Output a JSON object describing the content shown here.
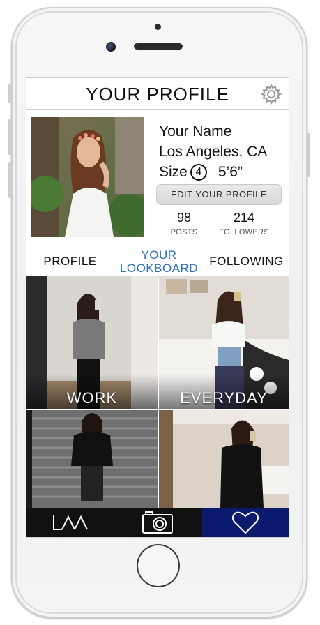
{
  "header": {
    "title": "YOUR PROFILE",
    "settings_icon": "gear-icon"
  },
  "profile": {
    "name": "Your Name",
    "location": "Los Angeles, CA",
    "size_label": "Size",
    "size_value": "4",
    "height": "5’6”",
    "edit_label": "EDIT YOUR PROFILE"
  },
  "stats": {
    "posts": {
      "value": "98",
      "label": "POSTS"
    },
    "followers": {
      "value": "214",
      "label": "FOLLOWERS"
    }
  },
  "tabs": [
    {
      "label": "PROFILE"
    },
    {
      "label_line1": "YOUR",
      "label_line2": "LOOKBOARD",
      "active": true
    },
    {
      "label": "FOLLOWING"
    }
  ],
  "boards": [
    {
      "label": "WORK"
    },
    {
      "label": "EVERYDAY"
    },
    {
      "label": ""
    },
    {
      "label": ""
    }
  ],
  "bottom_nav": [
    {
      "icon": "logo-icon"
    },
    {
      "icon": "camera-icon"
    },
    {
      "icon": "heart-icon",
      "active": true
    }
  ],
  "colors": {
    "accent": "#2a6fb8",
    "nav_active": "#0c1a6e",
    "nav_bg": "#111111"
  }
}
